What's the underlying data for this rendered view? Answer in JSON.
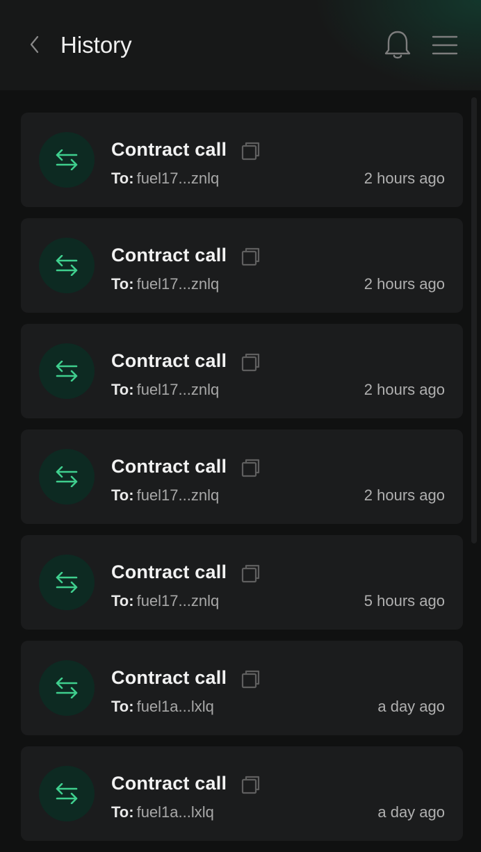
{
  "header": {
    "title": "History",
    "back_icon": "chevron-left-icon",
    "bell_icon": "bell-icon",
    "menu_icon": "hamburger-menu-icon"
  },
  "colors": {
    "accent": "#3fcf8e",
    "avatar_bg": "#0d2a22",
    "card_bg": "#1b1c1d",
    "page_bg": "#101111"
  },
  "transactions": [
    {
      "type": "Contract call",
      "to_label": "To:",
      "address": "fuel17...znlq",
      "time": "2 hours ago"
    },
    {
      "type": "Contract call",
      "to_label": "To:",
      "address": "fuel17...znlq",
      "time": "2 hours ago"
    },
    {
      "type": "Contract call",
      "to_label": "To:",
      "address": "fuel17...znlq",
      "time": "2 hours ago"
    },
    {
      "type": "Contract call",
      "to_label": "To:",
      "address": "fuel17...znlq",
      "time": "2 hours ago"
    },
    {
      "type": "Contract call",
      "to_label": "To:",
      "address": "fuel17...znlq",
      "time": "5 hours ago"
    },
    {
      "type": "Contract call",
      "to_label": "To:",
      "address": "fuel1a...lxlq",
      "time": "a day ago"
    },
    {
      "type": "Contract call",
      "to_label": "To:",
      "address": "fuel1a...lxlq",
      "time": "a day ago"
    }
  ]
}
